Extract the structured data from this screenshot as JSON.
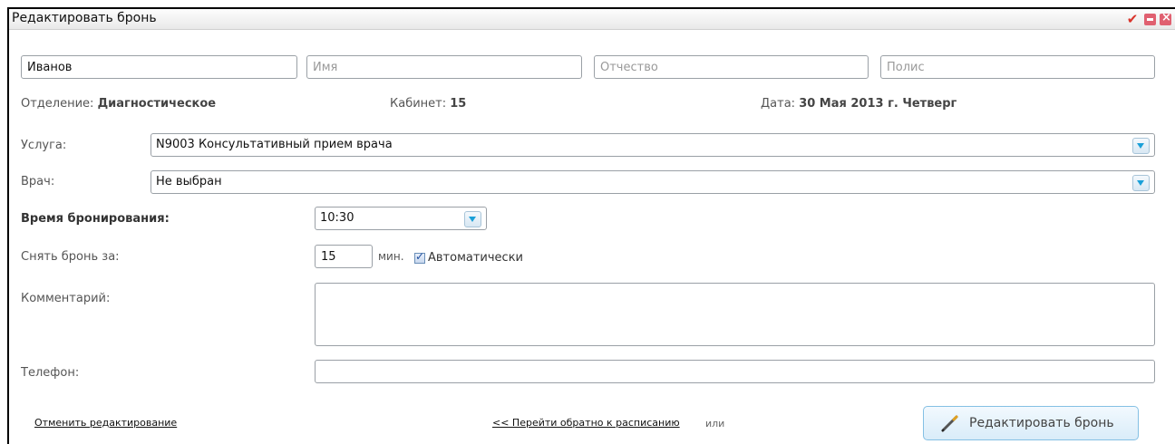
{
  "window": {
    "title": "Редактировать бронь"
  },
  "patient": {
    "lastname_value": "Иванов",
    "firstname_placeholder": "Имя",
    "patronymic_placeholder": "Отчество",
    "policy_placeholder": "Полис"
  },
  "info": {
    "department_label": "Отделение:",
    "department_value": "Диагностическое",
    "cabinet_label": "Кабинет:",
    "cabinet_value": "15",
    "date_label": "Дата:",
    "date_value": "30 Мая 2013 г. Четверг"
  },
  "service": {
    "label": "Услуга:",
    "value": "N9003 Консультативный прием врача"
  },
  "doctor": {
    "label": "Врач:",
    "value": "Не выбран"
  },
  "booking_time": {
    "label": "Время бронирования:",
    "value": "10:30"
  },
  "release": {
    "label": "Снять бронь за:",
    "value": "15",
    "unit": "мин.",
    "auto_label": "Автоматически",
    "auto_checked": true
  },
  "comment": {
    "label": "Комментарий:",
    "value": ""
  },
  "phone": {
    "label": "Телефон:",
    "value": ""
  },
  "footer": {
    "cancel_link": "Отменить редактирование",
    "back_link": "<< Перейти обратно к расписанию",
    "or_text": "или",
    "submit_button": "Редактировать бронь"
  },
  "icons": {
    "accept": "checkmark-icon",
    "minimize": "minimize-icon",
    "close": "close-icon",
    "button": "pencil-icon"
  }
}
